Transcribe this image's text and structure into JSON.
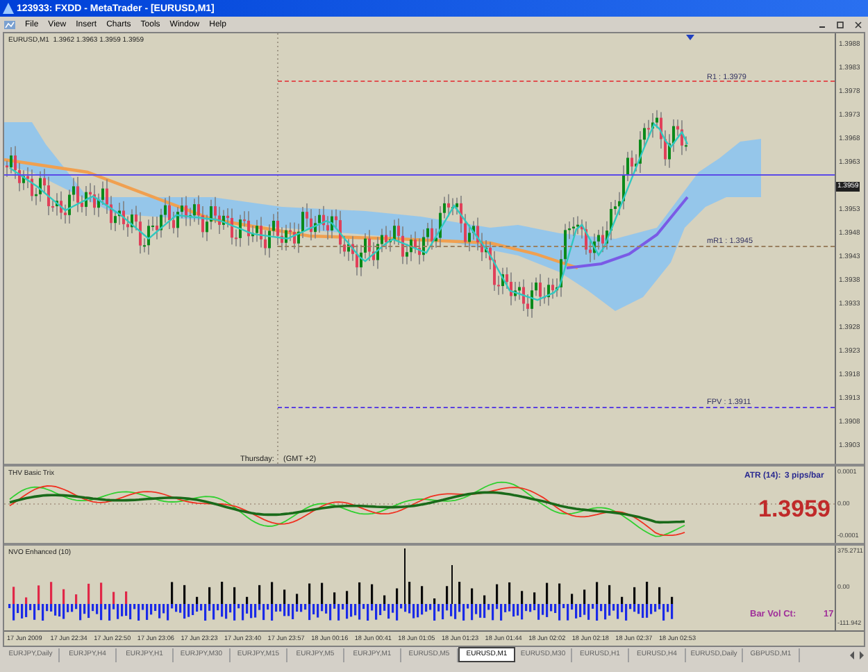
{
  "window": {
    "title": "123933: FXDD - MetaTrader - [EURUSD,M1]"
  },
  "menu": [
    "File",
    "View",
    "Insert",
    "Charts",
    "Tools",
    "Window",
    "Help"
  ],
  "chart": {
    "header": "EURUSD,M1  1.3962 1.3963 1.3959 1.3959",
    "levels": [
      {
        "label": "R1 : 1.3979",
        "color": "#e05050"
      },
      {
        "label": "mR1 : 1.3945",
        "color": "#9a8060"
      },
      {
        "label": "FPV : 1.3911",
        "color": "#5a40e0"
      }
    ],
    "session_day": "Thursday:",
    "timezone": "(GMT +2)",
    "price_axis": [
      {
        "text": "1.3988",
        "kind": "tick"
      },
      {
        "text": "1.3983",
        "kind": "tick"
      },
      {
        "text": "1.3978",
        "kind": "tick"
      },
      {
        "text": "1.3973",
        "kind": "tick"
      },
      {
        "text": "1.3968",
        "kind": "tick"
      },
      {
        "text": "1.3963",
        "kind": "tick"
      },
      {
        "text": "1.3959",
        "kind": "current"
      },
      {
        "text": "1.3953",
        "kind": "tick"
      },
      {
        "text": "1.3948",
        "kind": "tick"
      },
      {
        "text": "1.3943",
        "kind": "tick"
      },
      {
        "text": "1.3938",
        "kind": "tick"
      },
      {
        "text": "1.3933",
        "kind": "tick"
      },
      {
        "text": "1.3928",
        "kind": "tick"
      },
      {
        "text": "1.3923",
        "kind": "tick"
      },
      {
        "text": "1.3918",
        "kind": "tick"
      },
      {
        "text": "1.3913",
        "kind": "tick"
      },
      {
        "text": "1.3908",
        "kind": "tick"
      },
      {
        "text": "1.3903",
        "kind": "tick"
      }
    ]
  },
  "trix_panel": {
    "title": "THV Basic Trix",
    "atr_label": "ATR (14):",
    "atr_value": "3 pips/bar",
    "price": "1.3959",
    "axis": [
      "0.0001",
      "0.00",
      "-0.0001"
    ]
  },
  "volume_panel": {
    "title": "NVO Enhanced (10)",
    "bar_vol_label": "Bar Vol Ct:",
    "bar_vol_value": "17",
    "axis": [
      "375.2711",
      "0.00",
      "-111.942"
    ]
  },
  "time_axis": [
    "17 Jun 2009",
    "17 Jun 22:34",
    "17 Jun 22:50",
    "17 Jun 23:06",
    "17 Jun 23:23",
    "17 Jun 23:40",
    "17 Jun 23:57",
    "18 Jun 00:16",
    "18 Jun 00:41",
    "18 Jun 01:05",
    "18 Jun 01:23",
    "18 Jun 01:44",
    "18 Jun 02:02",
    "18 Jun 02:18",
    "18 Jun 02:37",
    "18 Jun 02:53"
  ],
  "tabs": [
    {
      "label": "EURJPY,Daily",
      "selected": false
    },
    {
      "label": "EURJPY,H4",
      "selected": false
    },
    {
      "label": "EURJPY,H1",
      "selected": false
    },
    {
      "label": "EURJPY,M30",
      "selected": false
    },
    {
      "label": "EURJPY,M15",
      "selected": false
    },
    {
      "label": "EURJPY,M5",
      "selected": false
    },
    {
      "label": "EURJPY,M1",
      "selected": false
    },
    {
      "label": "EURUSD,M5",
      "selected": false
    },
    {
      "label": "EURUSD,M1",
      "selected": true
    },
    {
      "label": "EURUSD,M30",
      "selected": false
    },
    {
      "label": "EURUSD,H1",
      "selected": false
    },
    {
      "label": "EURUSD,H4",
      "selected": false
    },
    {
      "label": "EURUSD,Daily",
      "selected": false
    },
    {
      "label": "GBPUSD,M1",
      "selected": false
    }
  ]
}
